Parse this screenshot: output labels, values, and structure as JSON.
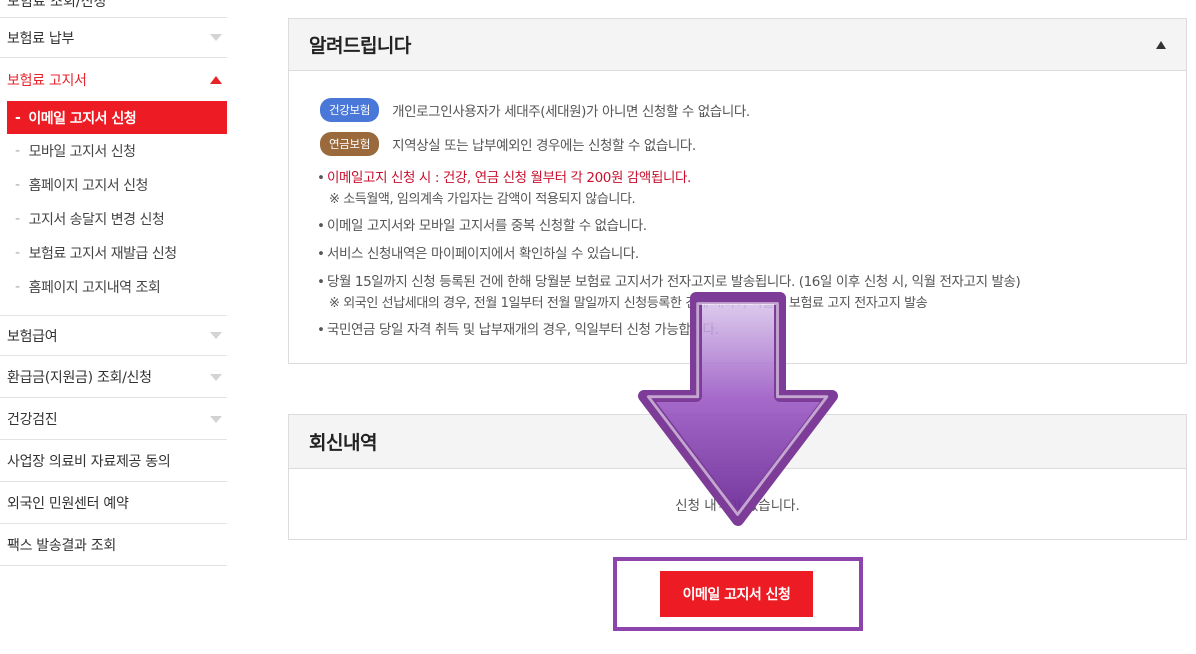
{
  "sidebar": {
    "cutoff_label": "보험료 조회/신청",
    "items": [
      {
        "label": "보험료 납부"
      },
      {
        "label": "보험료 고지서"
      },
      {
        "label": "보험급여"
      },
      {
        "label": "환급금(지원금) 조회/신청"
      },
      {
        "label": "건강검진"
      },
      {
        "label": "사업장 의료비 자료제공 동의"
      },
      {
        "label": "외국인 민원센터 예약"
      },
      {
        "label": "팩스 발송결과 조회"
      }
    ],
    "dash": "-",
    "subitems": [
      {
        "label": "이메일 고지서 신청"
      },
      {
        "label": "모바일 고지서 신청"
      },
      {
        "label": "홈페이지 고지서 신청"
      },
      {
        "label": "고지서 송달지 변경 신청"
      },
      {
        "label": "보험료 고지서 재발급 신청"
      },
      {
        "label": "홈페이지 고지내역 조회"
      }
    ]
  },
  "notice": {
    "title": "알려드립니다",
    "badges": [
      {
        "label": "건강보험",
        "text": "개인로그인사용자가 세대주(세대원)가 아니면 신청할 수 없습니다."
      },
      {
        "label": "연금보험",
        "text": "지역상실 또는 납부예외인 경우에는 신청할 수 없습니다."
      }
    ],
    "bullet_mark": "•",
    "bullets": [
      {
        "text": "이메일고지 신청 시 : 건강, 연금 신청 월부터 각 200원 감액됩니다.",
        "note": "※ 소득월액, 임의계속 가입자는 감액이 적용되지 않습니다."
      },
      {
        "text": "이메일 고지서와 모바일 고지서를 중복 신청할 수 없습니다."
      },
      {
        "text": "서비스 신청내역은 마이페이지에서 확인하실 수 있습니다."
      },
      {
        "text": "당월 15일까지 신청 등록된 건에 한해 당월분 보험료 고지서가 전자고지로 발송됩니다. (16일 이후 신청 시, 익월 전자고지 발송)",
        "note": "※ 외국인 선납세대의 경우, 전월 1일부터 전월 말일까지 신청등록한 건에 대하여 익월분 보험료 고지 전자고지 발송"
      },
      {
        "text": "국민연금 당일 자격 취득 및 납부재개의 경우, 익일부터 신청 가능합니다."
      }
    ]
  },
  "response": {
    "title": "회신내역",
    "empty": "신청 내역이 없습니다."
  },
  "apply_button": "이메일 고지서 신청",
  "colors": {
    "accent": "#ed1c24",
    "highlight_frame": "#8e44ad",
    "health_badge": "#4a78d8",
    "pension_badge": "#9a6a3d"
  }
}
